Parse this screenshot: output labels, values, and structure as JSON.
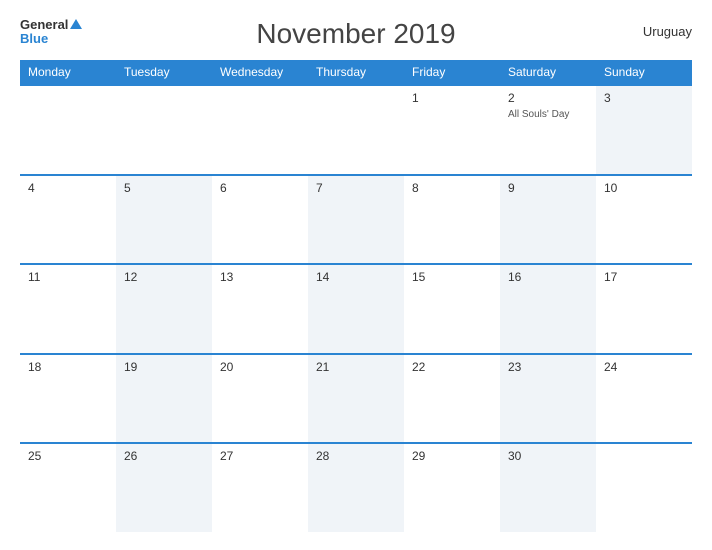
{
  "logo": {
    "general": "General",
    "blue": "Blue"
  },
  "title": "November 2019",
  "country": "Uruguay",
  "days_of_week": [
    "Monday",
    "Tuesday",
    "Wednesday",
    "Thursday",
    "Friday",
    "Saturday",
    "Sunday"
  ],
  "weeks": [
    [
      {
        "day": "",
        "event": "",
        "alt": false
      },
      {
        "day": "",
        "event": "",
        "alt": false
      },
      {
        "day": "",
        "event": "",
        "alt": false
      },
      {
        "day": "",
        "event": "",
        "alt": false
      },
      {
        "day": "1",
        "event": "",
        "alt": false
      },
      {
        "day": "2",
        "event": "All Souls' Day",
        "alt": false
      },
      {
        "day": "3",
        "event": "",
        "alt": true
      }
    ],
    [
      {
        "day": "4",
        "event": "",
        "alt": false
      },
      {
        "day": "5",
        "event": "",
        "alt": true
      },
      {
        "day": "6",
        "event": "",
        "alt": false
      },
      {
        "day": "7",
        "event": "",
        "alt": true
      },
      {
        "day": "8",
        "event": "",
        "alt": false
      },
      {
        "day": "9",
        "event": "",
        "alt": true
      },
      {
        "day": "10",
        "event": "",
        "alt": false
      }
    ],
    [
      {
        "day": "11",
        "event": "",
        "alt": false
      },
      {
        "day": "12",
        "event": "",
        "alt": true
      },
      {
        "day": "13",
        "event": "",
        "alt": false
      },
      {
        "day": "14",
        "event": "",
        "alt": true
      },
      {
        "day": "15",
        "event": "",
        "alt": false
      },
      {
        "day": "16",
        "event": "",
        "alt": true
      },
      {
        "day": "17",
        "event": "",
        "alt": false
      }
    ],
    [
      {
        "day": "18",
        "event": "",
        "alt": false
      },
      {
        "day": "19",
        "event": "",
        "alt": true
      },
      {
        "day": "20",
        "event": "",
        "alt": false
      },
      {
        "day": "21",
        "event": "",
        "alt": true
      },
      {
        "day": "22",
        "event": "",
        "alt": false
      },
      {
        "day": "23",
        "event": "",
        "alt": true
      },
      {
        "day": "24",
        "event": "",
        "alt": false
      }
    ],
    [
      {
        "day": "25",
        "event": "",
        "alt": false
      },
      {
        "day": "26",
        "event": "",
        "alt": true
      },
      {
        "day": "27",
        "event": "",
        "alt": false
      },
      {
        "day": "28",
        "event": "",
        "alt": true
      },
      {
        "day": "29",
        "event": "",
        "alt": false
      },
      {
        "day": "30",
        "event": "",
        "alt": true
      },
      {
        "day": "",
        "event": "",
        "alt": false
      }
    ]
  ],
  "colors": {
    "header_bg": "#2a84d2",
    "accent": "#2a84d2",
    "alt_cell": "#f0f4f8"
  }
}
